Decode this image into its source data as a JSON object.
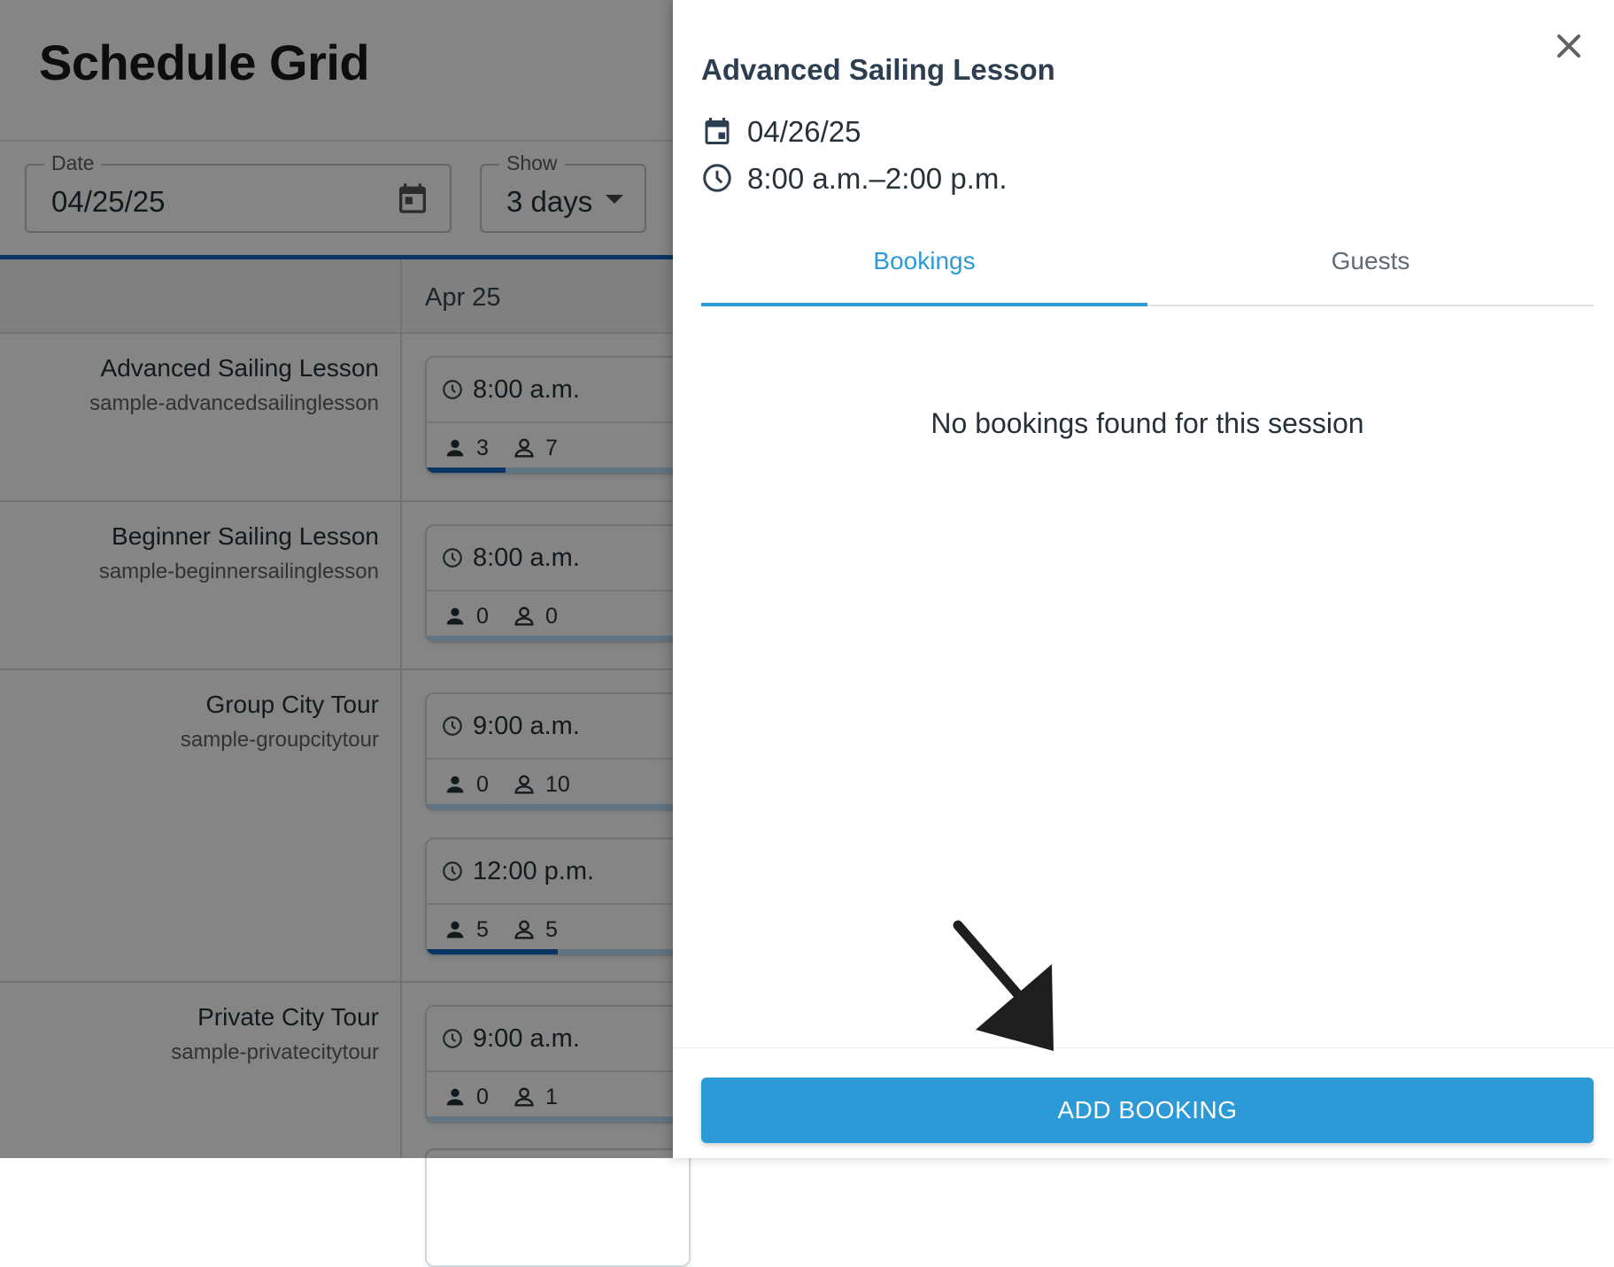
{
  "page": {
    "title": "Schedule Grid"
  },
  "filters": {
    "date": {
      "label": "Date",
      "value": "04/25/25"
    },
    "show": {
      "label": "Show",
      "value": "3 days"
    }
  },
  "grid": {
    "day_label": "Apr 25",
    "rows": [
      {
        "name": "Advanced Sailing Lesson",
        "slug": "sample-advancedsailinglesson",
        "sessions": [
          {
            "time": "8:00 a.m.",
            "booked": "3",
            "available": "7",
            "fill": 0.3
          }
        ]
      },
      {
        "name": "Beginner Sailing Lesson",
        "slug": "sample-beginnersailinglesson",
        "sessions": [
          {
            "time": "8:00 a.m.",
            "booked": "0",
            "available": "0",
            "fill": 0
          }
        ]
      },
      {
        "name": "Group City Tour",
        "slug": "sample-groupcitytour",
        "sessions": [
          {
            "time": "9:00 a.m.",
            "booked": "0",
            "available": "10",
            "fill": 0
          },
          {
            "time": "12:00 p.m.",
            "booked": "5",
            "available": "5",
            "fill": 0.5
          }
        ]
      },
      {
        "name": "Private City Tour",
        "slug": "sample-privatecitytour",
        "sessions": [
          {
            "time": "9:00 a.m.",
            "booked": "0",
            "available": "1",
            "fill": 0
          }
        ]
      }
    ]
  },
  "drawer": {
    "title": "Advanced Sailing Lesson",
    "date": "04/26/25",
    "time_range": "8:00 a.m.–2:00 p.m.",
    "tabs": [
      {
        "label": "Bookings",
        "active": true
      },
      {
        "label": "Guests",
        "active": false
      }
    ],
    "empty_message": "No bookings found for this session",
    "add_booking_label": "ADD BOOKING"
  },
  "colors": {
    "accent": "#2d9ad8",
    "progress": "#1565c0",
    "overlay": "rgba(0,0,0,0.48)"
  },
  "icons": [
    "calendar-icon",
    "dropdown-caret-icon",
    "clock-icon",
    "person-filled-icon",
    "person-outline-icon",
    "close-icon",
    "arrow-annotation-icon"
  ]
}
